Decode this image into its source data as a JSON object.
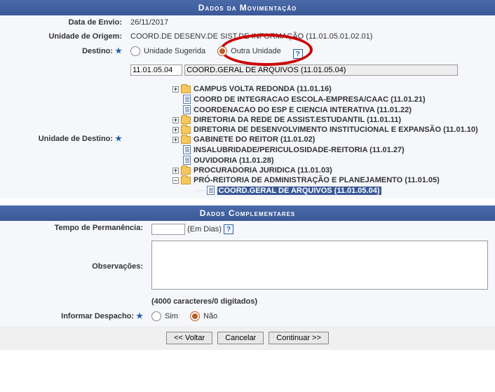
{
  "section1": {
    "title": "Dados da Movimentação"
  },
  "section2": {
    "title": "Dados Complementares"
  },
  "labels": {
    "dataEnvio": "Data de Envio:",
    "unidadeOrigem": "Unidade de Origem:",
    "destino": "Destino:",
    "unidadeDestino": "Unidade de Destino:",
    "tempoPermanencia": "Tempo de Permanência:",
    "observacoes": "Observações:",
    "informarDespacho": "Informar Despacho:"
  },
  "values": {
    "dataEnvio": "26/11/2017",
    "unidadeOrigem": "COORD.DE DESENV.DE SIST.DE INFORMAÇÃO (11.01.05.01.02.01)",
    "codigoUnidade": "11.01.05.04",
    "nomeUnidade": "COORD.GERAL DE ARQUIVOS (11.01.05.04)",
    "emDias": "(Em Dias)",
    "charCount": "(4000 caracteres/0 digitados)"
  },
  "radios": {
    "unidadeSugerida": "Unidade Sugerida",
    "outraUnidade": "Outra Unidade",
    "sim": "Sim",
    "nao": "Não"
  },
  "tree": {
    "n0": "CAMPUS VOLTA REDONDA (11.01.16)",
    "n1": "COORD DE INTEGRACAO ESCOLA-EMPRESA/CAAC (11.01.21)",
    "n2": "COORDENACAO DO ESP E CIENCIA INTERATIVA (11.01.22)",
    "n3": "DIRETORIA DA REDE DE ASSIST.ESTUDANTIL (11.01.11)",
    "n4": "DIRETORIA DE DESENVOLVIMENTO INSTITUCIONAL E EXPANSÃO (11.01.10)",
    "n5": "GABINETE DO REITOR (11.01.02)",
    "n6": "INSALUBRIDADE/PERICULOSIDADE-REITORIA (11.01.27)",
    "n7": "OUVIDORIA (11.01.28)",
    "n8": "PROCURADORIA JURIDICA (11.01.03)",
    "n9": "PRÓ-REITORIA DE ADMINISTRAÇÃO E PLANEJAMENTO (11.01.05)",
    "n10": "COORD.GERAL DE ARQUIVOS (11.01.05.04)"
  },
  "buttons": {
    "voltar": "<< Voltar",
    "cancelar": "Cancelar",
    "continuar": "Continuar >>"
  }
}
